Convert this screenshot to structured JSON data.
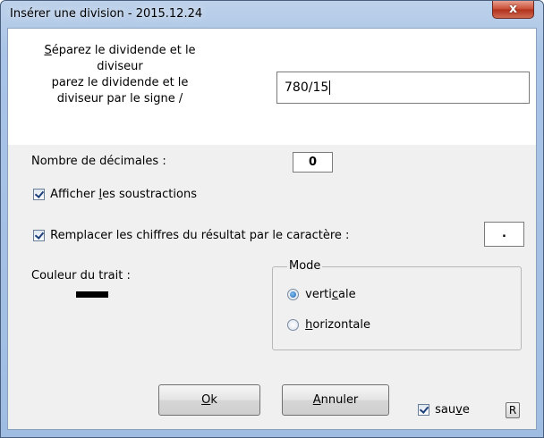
{
  "window": {
    "title": "Insérer une division - 2015.12.24",
    "close_glyph": "x"
  },
  "form": {
    "separator_label": "Séparez le dividende et le diviseur par le signe /",
    "dividend_value": "780/15",
    "decimals_label": "Nombre de décimales :",
    "decimals_value": "0",
    "show_subtractions_label": "Afficher les soustractions",
    "show_subtractions_checked": true,
    "replace_digits_label": "Remplacer les chiffres du résultat par le caractère :",
    "replace_digits_checked": true,
    "replace_char_value": ".",
    "line_color_label": "Couleur du trait :",
    "line_color": "#000000"
  },
  "mode": {
    "legend": "Mode",
    "options": [
      "verticale",
      "horizontale"
    ],
    "selected": "verticale"
  },
  "buttons": {
    "ok": "Ok",
    "cancel": "Annuler",
    "save_label": "sauve",
    "save_checked": true,
    "reset": "R"
  },
  "colors": {
    "title_gradient": "#a9c4e6",
    "close": "#c84a32",
    "client_bg": "#f0f0f0"
  }
}
